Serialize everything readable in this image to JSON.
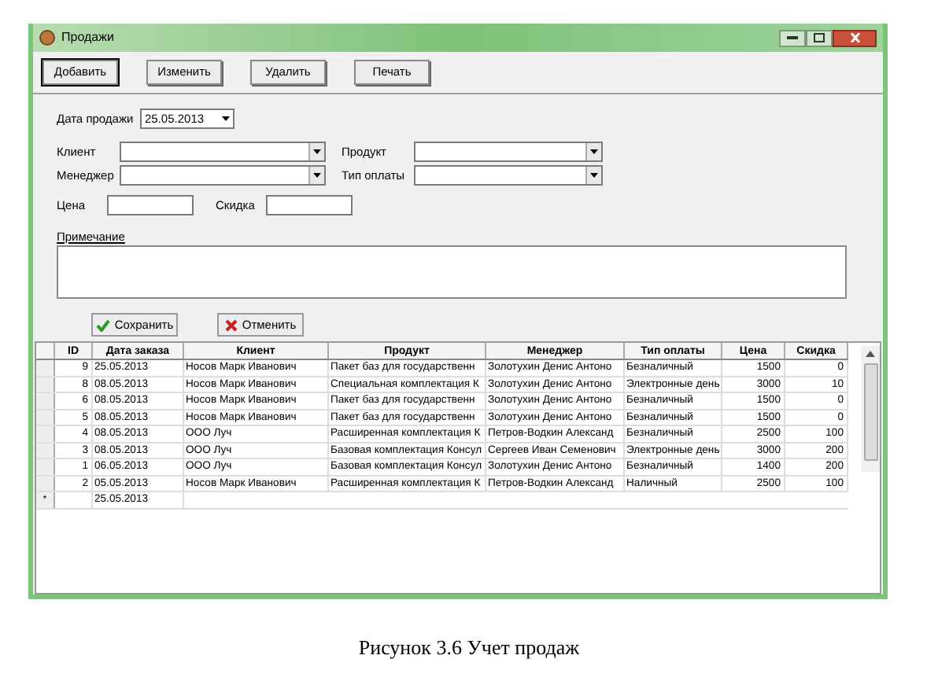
{
  "window": {
    "title": "Продажи"
  },
  "toolbar": [
    "Добавить",
    "Изменить",
    "Удалить",
    "Печать"
  ],
  "form": {
    "sale_date": {
      "label": "Дата продажи",
      "value": "25.05.2013"
    },
    "client": {
      "label": "Клиент"
    },
    "product": {
      "label": "Продукт"
    },
    "manager": {
      "label": "Менеджер"
    },
    "payment_type": {
      "label": "Тип оплаты"
    },
    "price": {
      "label": "Цена"
    },
    "discount": {
      "label": "Скидка"
    },
    "note": {
      "label": "Примечание"
    }
  },
  "actions": [
    {
      "kind": "save",
      "label": "Сохранить"
    },
    {
      "kind": "cancel",
      "label": "Отменить"
    }
  ],
  "table": {
    "columns": [
      "ID",
      "Дата заказа",
      "Клиент",
      "Продукт",
      "Менеджер",
      "Тип оплаты",
      "Цена",
      "Скидка"
    ],
    "rows": [
      [
        "9",
        "25.05.2013",
        "Носов Марк Иванович",
        "Пакет баз для государственн",
        "Золотухин Денис Антоно",
        "Безналичный",
        "1500",
        "0"
      ],
      [
        "8",
        "08.05.2013",
        "Носов Марк Иванович",
        "Специальная комплектация К",
        "Золотухин Денис Антоно",
        "Электронные день",
        "3000",
        "10"
      ],
      [
        "6",
        "08.05.2013",
        "Носов Марк Иванович",
        "Пакет баз для государственн",
        "Золотухин Денис Антоно",
        "Безналичный",
        "1500",
        "0"
      ],
      [
        "5",
        "08.05.2013",
        "Носов Марк Иванович",
        "Пакет баз для государственн",
        "Золотухин Денис Антоно",
        "Безналичный",
        "1500",
        "0"
      ],
      [
        "4",
        "08.05.2013",
        "ООО Луч",
        "Расширенная комплектация К",
        "Петров-Водкин Александ",
        "Безналичный",
        "2500",
        "100"
      ],
      [
        "3",
        "08.05.2013",
        "ООО Луч",
        "Базовая комплектация Консул",
        "Сергеев Иван Семенович",
        "Электронные день",
        "3000",
        "200"
      ],
      [
        "1",
        "06.05.2013",
        "ООО Луч",
        "Базовая комплектация Консул",
        "Золотухин Денис Антоно",
        "Безналичный",
        "1400",
        "200"
      ],
      [
        "2",
        "05.05.2013",
        "Носов Марк Иванович",
        "Расширенная комплектация К",
        "Петров-Водкин Александ",
        "Наличный",
        "2500",
        "100"
      ]
    ],
    "new_row": {
      "marker": "*",
      "date": "25.05.2013"
    }
  },
  "caption": "Рисунок 3.6 Учет продаж"
}
